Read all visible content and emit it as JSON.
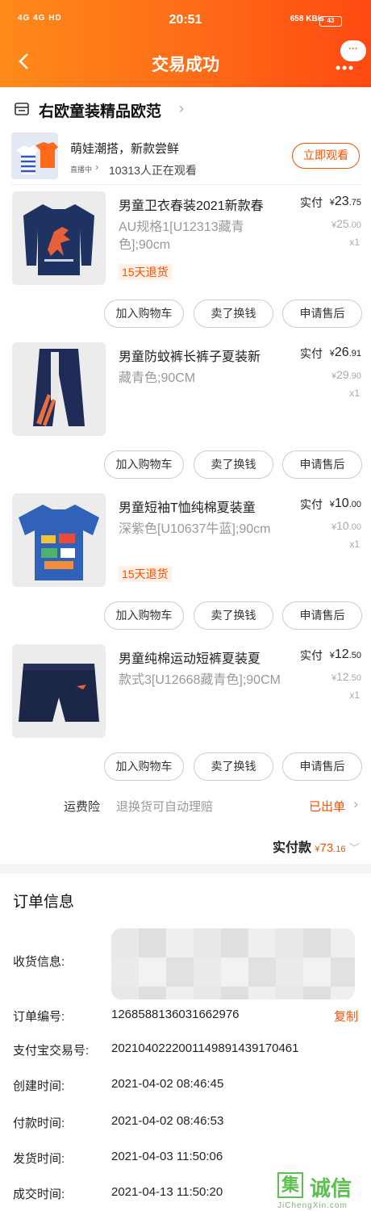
{
  "status_bar": {
    "time": "20:51",
    "left": "4G 4G HD",
    "speed": "658 KB/s",
    "battery": "43"
  },
  "nav": {
    "title": "交易成功",
    "back_icon": "chevron-left-icon",
    "more_icon": "more-icon",
    "bubble": "···"
  },
  "shop": {
    "name": "右欧童装精品欧范"
  },
  "live": {
    "slogan": "萌娃潮搭，新款尝鲜",
    "tag": "直播中",
    "viewers": "10313人正在观看",
    "button": "立即观看"
  },
  "products": [
    {
      "name": "男童卫衣春装2021新款春",
      "spec": "AU规格1[U12313藏青色];90cm",
      "badge": "15天退货",
      "paid_label": "实付",
      "paid_currency": "¥",
      "paid_int": "23",
      "paid_dec": ".75",
      "orig_currency": "¥",
      "orig_int": "25",
      "orig_dec": ".00",
      "qty": "x1"
    },
    {
      "name": "男童防蚊裤长裤子夏装新",
      "spec": "藏青色;90CM",
      "badge": "",
      "paid_label": "实付",
      "paid_currency": "¥",
      "paid_int": "26",
      "paid_dec": ".91",
      "orig_currency": "¥",
      "orig_int": "29",
      "orig_dec": ".90",
      "qty": "x1"
    },
    {
      "name": "男童短袖T恤纯棉夏装童",
      "spec": "深紫色[U10637牛蓝];90cm",
      "badge": "15天退货",
      "paid_label": "实付",
      "paid_currency": "¥",
      "paid_int": "10",
      "paid_dec": ".00",
      "orig_currency": "¥",
      "orig_int": "10",
      "orig_dec": ".00",
      "qty": "x1"
    },
    {
      "name": "男童纯棉运动短裤夏装夏",
      "spec": "款式3[U12668藏青色];90CM",
      "badge": "",
      "paid_label": "实付",
      "paid_currency": "¥",
      "paid_int": "12",
      "paid_dec": ".50",
      "orig_currency": "¥",
      "orig_int": "12",
      "orig_dec": ".50",
      "qty": "x1"
    }
  ],
  "actions": {
    "add_cart": "加入购物车",
    "resell": "卖了换钱",
    "after_sale": "申请售后"
  },
  "freight": {
    "label": "运费险",
    "desc": "退换货可自动理赔",
    "status": "已出单"
  },
  "total": {
    "label": "实付款",
    "currency": "¥",
    "int": "73",
    "dec": ".16"
  },
  "order": {
    "title": "订单信息",
    "receiver_label": "收货信息:",
    "order_no_label": "订单编号:",
    "order_no": "1268588136031662976",
    "copy": "复制",
    "alipay_label": "支付宝交易号:",
    "alipay_no": "2021040222001149891439170461",
    "created_label": "创建时间:",
    "created": "2021-04-02 08:46:45",
    "paid_label": "付款时间:",
    "paid": "2021-04-02 08:46:53",
    "shipped_label": "发货时间:",
    "shipped": "2021-04-03 11:50:06",
    "done_label": "成交时间:",
    "done": "2021-04-13 11:50:20"
  },
  "watermark": {
    "text": "诚信",
    "url": "JiChengXin.com"
  },
  "colors": {
    "brand": "#ff5000",
    "header_start": "#ff8a1a",
    "header_end": "#ff4a12"
  }
}
